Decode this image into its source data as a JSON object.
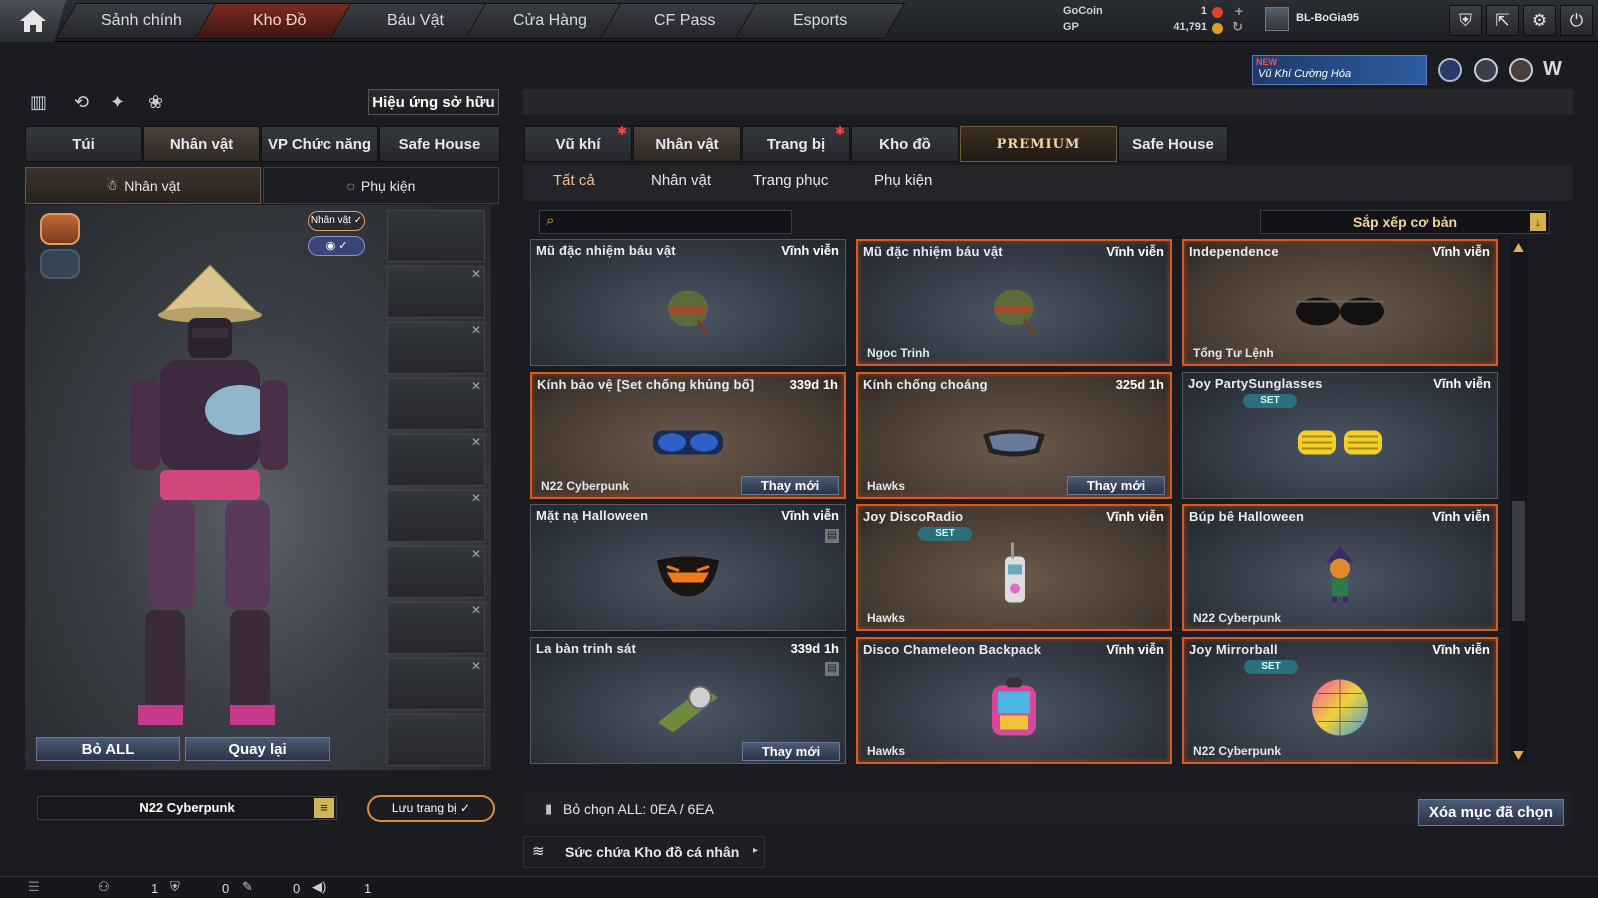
{
  "nav": {
    "tabs": [
      "Sảnh chính",
      "Kho Đồ",
      "Báu Vật",
      "Cửa Hàng",
      "CF Pass",
      "Esports"
    ],
    "active": "Kho Đồ"
  },
  "currency": {
    "gocoin_label": "GoCoin",
    "gocoin_value": "1",
    "gp_label": "GP",
    "gp_value": "41,791"
  },
  "user": {
    "name": "BL-BoGia95"
  },
  "promo": {
    "new": "NEW",
    "text": "Vũ Khí Cường Hóa"
  },
  "left": {
    "effects_button": "Hiệu ứng sở hữu",
    "tabs": [
      "Túi",
      "Nhân vật",
      "VP Chức năng",
      "Safe House"
    ],
    "subtabs": [
      "Nhân vật",
      "Phụ kiện"
    ],
    "char_toggle": "Nhân vật",
    "remove_all": "Bỏ ALL",
    "back": "Quay lại",
    "preset_name": "N22 Cyberpunk",
    "save_button": "Lưu trang bị"
  },
  "right": {
    "tabs": [
      "Vũ khí",
      "Nhân vật",
      "Trang bị",
      "Kho đồ",
      "PREMIUM",
      "Safe House"
    ],
    "categories": [
      "Tất cả",
      "Nhân vật",
      "Trang phục",
      "Phụ kiện"
    ],
    "search_placeholder": "",
    "sort_label": "Sắp xếp cơ bản",
    "items": [
      {
        "name": "Mũ đặc nhiệm báu vật",
        "duration": "Vĩnh viễn",
        "owner": "",
        "theme": "blue",
        "selected": false,
        "set": false,
        "replace": false,
        "trash": false,
        "icon": "helmet"
      },
      {
        "name": "Mũ đặc nhiệm báu vật",
        "duration": "Vĩnh viễn",
        "owner": "Ngoc Trinh",
        "theme": "blue",
        "selected": true,
        "set": false,
        "replace": false,
        "trash": false,
        "icon": "helmet"
      },
      {
        "name": "Independence",
        "duration": "Vĩnh viễn",
        "owner": "Tổng Tư Lệnh",
        "theme": "brown",
        "selected": true,
        "set": false,
        "replace": false,
        "trash": false,
        "icon": "sunglasses"
      },
      {
        "name": "Kính bảo vệ [Set chống khủng bố]",
        "duration": "339d 1h",
        "owner": "N22 Cyberpunk",
        "theme": "brown",
        "selected": true,
        "set": false,
        "replace": true,
        "trash": false,
        "icon": "goggles"
      },
      {
        "name": "Kính chống choáng",
        "duration": "325d 1h",
        "owner": "Hawks",
        "theme": "brown",
        "selected": true,
        "set": false,
        "replace": true,
        "trash": false,
        "icon": "visor"
      },
      {
        "name": "Joy PartySunglasses",
        "duration": "Vĩnh viễn",
        "owner": "",
        "theme": "blue",
        "selected": false,
        "set": true,
        "replace": false,
        "trash": false,
        "icon": "party-glasses"
      },
      {
        "name": "Mặt nạ Halloween",
        "duration": "Vĩnh viễn",
        "owner": "",
        "theme": "blue",
        "selected": false,
        "set": false,
        "replace": false,
        "trash": true,
        "icon": "mask"
      },
      {
        "name": "Joy DiscoRadio",
        "duration": "Vĩnh viễn",
        "owner": "Hawks",
        "theme": "brown",
        "selected": true,
        "set": true,
        "replace": false,
        "trash": false,
        "icon": "radio"
      },
      {
        "name": "Búp bê Halloween",
        "duration": "Vĩnh viễn",
        "owner": "N22 Cyberpunk",
        "theme": "blue",
        "selected": true,
        "set": false,
        "replace": false,
        "trash": false,
        "icon": "doll"
      },
      {
        "name": "La bàn trinh sát",
        "duration": "339d 1h",
        "owner": "",
        "theme": "blue",
        "selected": false,
        "set": false,
        "replace": true,
        "trash": true,
        "icon": "compass"
      },
      {
        "name": "Disco Chameleon Backpack",
        "duration": "Vĩnh viễn",
        "owner": "Hawks",
        "theme": "blue",
        "selected": true,
        "set": false,
        "replace": false,
        "trash": false,
        "icon": "backpack"
      },
      {
        "name": "Joy Mirrorball",
        "duration": "Vĩnh viễn",
        "owner": "N22 Cyberpunk",
        "theme": "blue",
        "selected": true,
        "set": true,
        "replace": false,
        "trash": false,
        "icon": "mirrorball"
      }
    ],
    "replace_label": "Thay mới",
    "set_label": "SET",
    "deselect_text": "Bỏ chọn ALL: 0EA / 6EA",
    "delete_button": "Xóa mục đã chọn",
    "capacity_label": "Sức chứa Kho đồ cá nhân"
  },
  "statusbar": {
    "v1": "1",
    "v2": "0",
    "v3": "0",
    "v4": "1"
  },
  "colors": {
    "accent": "#d65a27",
    "active_tab": "#7a2a22",
    "set_badge": "#2c6f7d"
  }
}
